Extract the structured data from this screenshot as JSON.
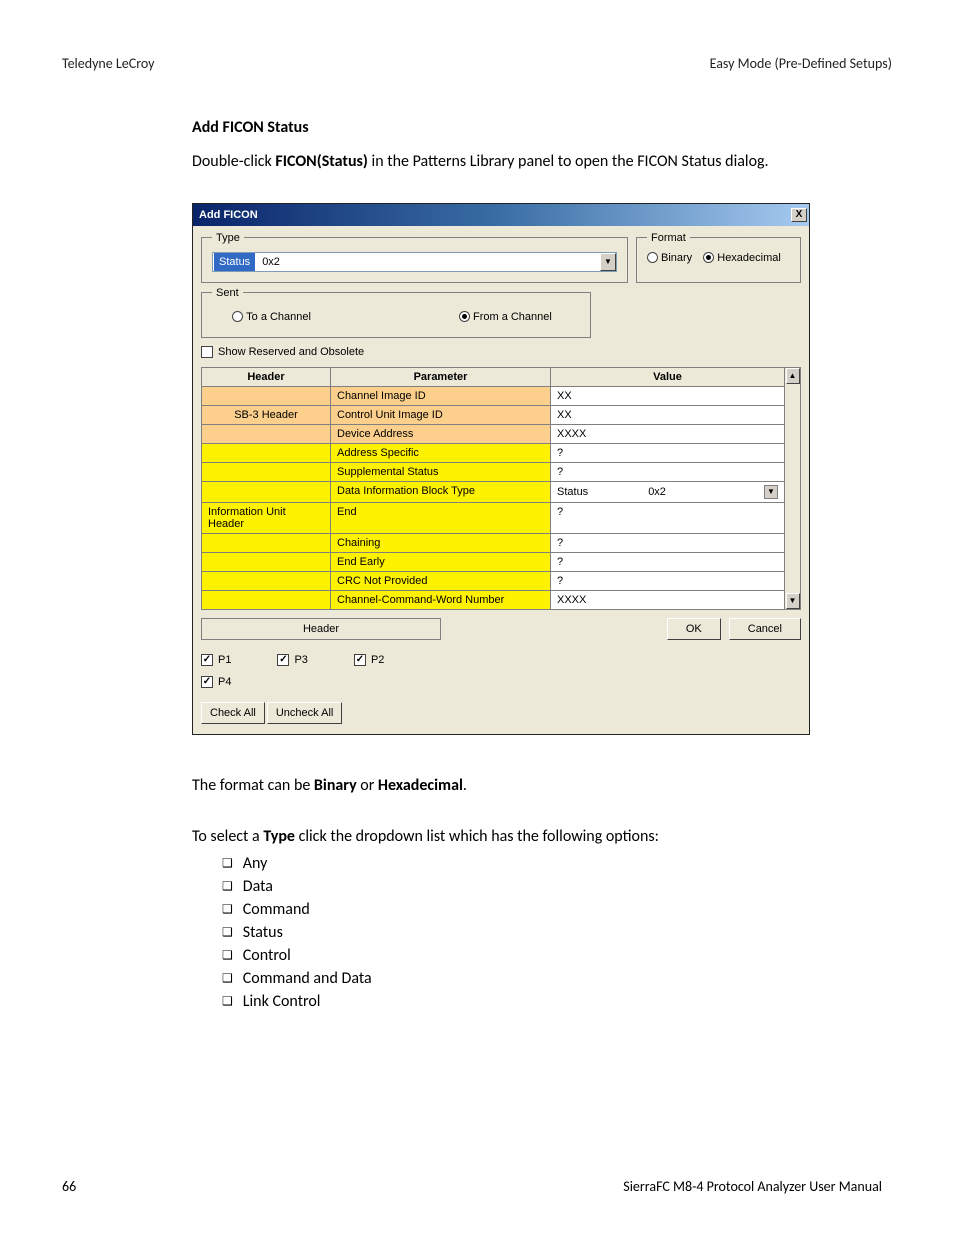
{
  "page_header": {
    "left": "Teledyne LeCroy",
    "right": "Easy Mode (Pre-Defined Setups)"
  },
  "heading": "Add FICON Status",
  "intro_pre": "Double-click ",
  "intro_bold": "FICON(Status)",
  "intro_post": " in the Patterns Library panel to open the FICON Status dialog.",
  "dialog": {
    "title": "Add FICON",
    "close": "X",
    "type": {
      "legend": "Type",
      "selected": "Status",
      "code": "0x2"
    },
    "format": {
      "legend": "Format",
      "binary": "Binary",
      "hex": "Hexadecimal"
    },
    "sent": {
      "legend": "Sent",
      "to": "To a Channel",
      "from": "From a Channel"
    },
    "show_obsolete": "Show Reserved and Obsolete",
    "columns": {
      "h": "Header",
      "p": "Parameter",
      "v": "Value"
    },
    "rows": [
      {
        "group": "SB-3 Header",
        "param": "Channel Image ID",
        "value": "XX",
        "cls": "sb3"
      },
      {
        "group": "",
        "param": "Control Unit Image ID",
        "value": "XX",
        "cls": "sb3"
      },
      {
        "group": "",
        "param": "Device Address",
        "value": "XXXX",
        "cls": "sb3"
      },
      {
        "group": "Information Unit Header",
        "param": "Address Specific",
        "value": "?",
        "cls": "iuh"
      },
      {
        "group": "",
        "param": "Supplemental Status",
        "value": "?",
        "cls": "iuh"
      },
      {
        "group": "",
        "param": "Data Information Block Type",
        "value": "Status",
        "valueCode": "0x2",
        "cls": "iuh",
        "dd": true
      },
      {
        "group": "",
        "param": "End",
        "value": "?",
        "cls": "iuh"
      },
      {
        "group": "",
        "param": "Chaining",
        "value": "?",
        "cls": "iuh"
      },
      {
        "group": "",
        "param": "End Early",
        "value": "?",
        "cls": "iuh"
      },
      {
        "group": "",
        "param": "CRC Not Provided",
        "value": "?",
        "cls": "iuh"
      },
      {
        "group": "",
        "param": "Channel-Command-Word Number",
        "value": "XXXX",
        "cls": "iuh"
      }
    ],
    "footer_header": "Header",
    "ok": "OK",
    "cancel": "Cancel",
    "p_checks": [
      "P1",
      "P3",
      "P2",
      "P4"
    ],
    "check_all": "Check All",
    "uncheck_all": "Uncheck All"
  },
  "after1_pre": "The format can be ",
  "after1_b1": "Binary",
  "after1_mid": " or ",
  "after1_b2": "Hexadecimal",
  "after1_post": ".",
  "after2_pre": "To select a ",
  "after2_b": "Type",
  "after2_post": " click the dropdown list which has the following options:",
  "type_options": [
    "Any",
    "Data",
    "Command",
    "Status",
    "Control",
    "Command and Data",
    "Link Control"
  ],
  "page_footer": {
    "left": "66",
    "right": "SierraFC M8-4 Protocol Analyzer User Manual"
  }
}
